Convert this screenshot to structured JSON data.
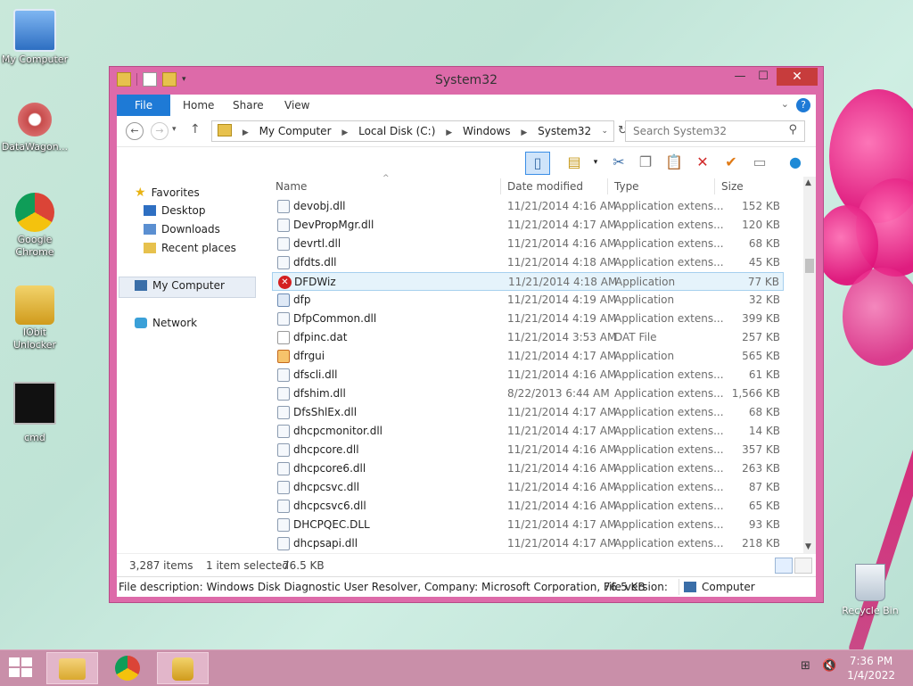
{
  "desktop": {
    "icons": [
      {
        "label": "My Computer"
      },
      {
        "label": "DataWagon..."
      },
      {
        "label": "Google Chrome"
      },
      {
        "label": "IObit Unlocker"
      },
      {
        "label": "cmd"
      }
    ],
    "recycle_bin": "Recycle Bin"
  },
  "window": {
    "title": "System32",
    "controls": {
      "minimize": "—",
      "maximize": "☐",
      "close": "✕"
    },
    "ribbon_tabs": [
      "File",
      "Home",
      "Share",
      "View"
    ],
    "help": "?",
    "address": {
      "crumbs": [
        "My Computer",
        "Local Disk (C:)",
        "Windows",
        "System32"
      ]
    },
    "search": {
      "placeholder": "Search System32"
    },
    "nav_pane": {
      "favorites": "Favorites",
      "favorites_items": [
        "Desktop",
        "Downloads",
        "Recent places"
      ],
      "my_computer": "My Computer",
      "network": "Network"
    },
    "columns": {
      "name": "Name",
      "date": "Date modified",
      "type": "Type",
      "size": "Size"
    },
    "files": [
      {
        "name": "devobj.dll",
        "date": "11/21/2014 4:16 AM",
        "type": "Application extens...",
        "size": "152 KB",
        "icon": "dll"
      },
      {
        "name": "DevPropMgr.dll",
        "date": "11/21/2014 4:17 AM",
        "type": "Application extens...",
        "size": "120 KB",
        "icon": "dll"
      },
      {
        "name": "devrtl.dll",
        "date": "11/21/2014 4:16 AM",
        "type": "Application extens...",
        "size": "68 KB",
        "icon": "dll"
      },
      {
        "name": "dfdts.dll",
        "date": "11/21/2014 4:18 AM",
        "type": "Application extens...",
        "size": "45 KB",
        "icon": "dll"
      },
      {
        "name": "DFDWiz",
        "date": "11/21/2014 4:18 AM",
        "type": "Application",
        "size": "77 KB",
        "icon": "error",
        "selected": true
      },
      {
        "name": "dfp",
        "date": "11/21/2014 4:19 AM",
        "type": "Application",
        "size": "32 KB",
        "icon": "app"
      },
      {
        "name": "DfpCommon.dll",
        "date": "11/21/2014 4:19 AM",
        "type": "Application extens...",
        "size": "399 KB",
        "icon": "dll"
      },
      {
        "name": "dfpinc.dat",
        "date": "11/21/2014 3:53 AM",
        "type": "DAT File",
        "size": "257 KB",
        "icon": "dat"
      },
      {
        "name": "dfrgui",
        "date": "11/21/2014 4:17 AM",
        "type": "Application",
        "size": "565 KB",
        "icon": "dfrg"
      },
      {
        "name": "dfscli.dll",
        "date": "11/21/2014 4:16 AM",
        "type": "Application extens...",
        "size": "61 KB",
        "icon": "dll"
      },
      {
        "name": "dfshim.dll",
        "date": "8/22/2013 6:44 AM",
        "type": "Application extens...",
        "size": "1,566 KB",
        "icon": "dll"
      },
      {
        "name": "DfsShlEx.dll",
        "date": "11/21/2014 4:17 AM",
        "type": "Application extens...",
        "size": "68 KB",
        "icon": "dll"
      },
      {
        "name": "dhcpcmonitor.dll",
        "date": "11/21/2014 4:17 AM",
        "type": "Application extens...",
        "size": "14 KB",
        "icon": "dll"
      },
      {
        "name": "dhcpcore.dll",
        "date": "11/21/2014 4:16 AM",
        "type": "Application extens...",
        "size": "357 KB",
        "icon": "dll"
      },
      {
        "name": "dhcpcore6.dll",
        "date": "11/21/2014 4:16 AM",
        "type": "Application extens...",
        "size": "263 KB",
        "icon": "dll"
      },
      {
        "name": "dhcpcsvc.dll",
        "date": "11/21/2014 4:16 AM",
        "type": "Application extens...",
        "size": "87 KB",
        "icon": "dll"
      },
      {
        "name": "dhcpcsvc6.dll",
        "date": "11/21/2014 4:16 AM",
        "type": "Application extens...",
        "size": "65 KB",
        "icon": "dll"
      },
      {
        "name": "DHCPQEC.DLL",
        "date": "11/21/2014 4:17 AM",
        "type": "Application extens...",
        "size": "93 KB",
        "icon": "dll"
      },
      {
        "name": "dhcpsapi.dll",
        "date": "11/21/2014 4:17 AM",
        "type": "Application extens...",
        "size": "218 KB",
        "icon": "dll"
      }
    ],
    "status": {
      "items": "3,287 items",
      "selected": "1 item selected",
      "selected_size": "76.5 KB"
    },
    "details_bar": {
      "description": "File description: Windows Disk Diagnostic User Resolver, Company: Microsoft Corporation, File version:",
      "size": "76.5 KB",
      "computer": "Computer"
    }
  },
  "taskbar": {
    "time": "7:36 PM",
    "date": "1/4/2022"
  },
  "colors": {
    "accent": "#1e7ad6",
    "window_frame": "#dd6aa9",
    "taskbar": "#c98fa9",
    "close": "#c73c3c"
  }
}
